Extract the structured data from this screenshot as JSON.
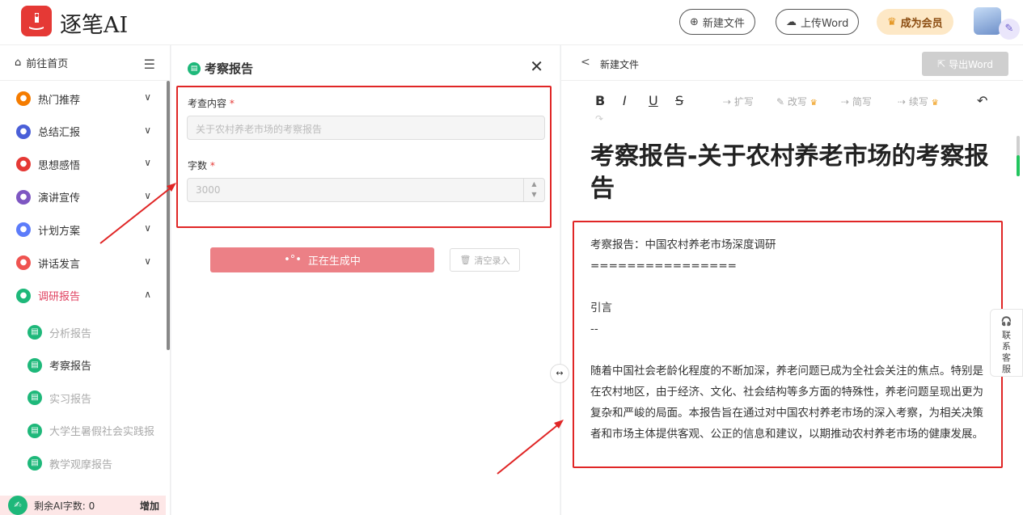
{
  "app": {
    "logo_text": "逐笔AI",
    "new_file_label": "新建文件",
    "upload_label": "上传Word",
    "vip_label": "成为会员"
  },
  "sidebar": {
    "home_label": "前往首页",
    "items": [
      {
        "label": "热门推荐",
        "icon_color": "#f57c00",
        "chevron": "∨"
      },
      {
        "label": "总结汇报",
        "icon_color": "#4a5fd8",
        "chevron": "∨"
      },
      {
        "label": "思想感悟",
        "icon_color": "#e53935",
        "chevron": "∨"
      },
      {
        "label": "演讲宣传",
        "icon_color": "#7e57c2",
        "chevron": "∨"
      },
      {
        "label": "计划方案",
        "icon_color": "#5c7cfa",
        "chevron": "∨"
      },
      {
        "label": "讲话发言",
        "icon_color": "#ef5350",
        "chevron": "∨"
      },
      {
        "label": "调研报告",
        "icon_color": "#1eb87a",
        "chevron": "∧"
      }
    ],
    "sub_items": [
      "分析报告",
      "考察报告",
      "实习报告",
      "大学生暑假社会实践报",
      "教学观摩报告"
    ],
    "remaining_label": "剩余AI字数: 0",
    "add_label": "增加"
  },
  "form": {
    "title": "考察报告",
    "close": "✕",
    "content_label": "考查内容",
    "content_placeholder": "关于农村养老市场的考察报告",
    "count_label": "字数",
    "count_placeholder": "3000",
    "required_mark": "*",
    "generate_label": "正在生成中",
    "clear_label": "清空录入"
  },
  "editor": {
    "file_label": "新建文件",
    "export_label": "导出Word",
    "toolbar": {
      "bold": "B",
      "italic": "I",
      "underline": "U",
      "strike": "S",
      "expand": "扩写",
      "rewrite": "改写",
      "simplify": "简写",
      "continue": "续写"
    },
    "doc_title": "考察报告-关于农村养老市场的考察报告",
    "body": {
      "line1": "考察报告：中国农村养老市场深度调研",
      "rule": "================",
      "intro_head": "引言",
      "intro_rule": "--",
      "paragraph": "随着中国社会老龄化程度的不断加深，养老问题已成为全社会关注的焦点。特别是在农村地区，由于经济、文化、社会结构等多方面的特殊性，养老问题呈现出更为复杂和严峻的局面。本报告旨在通过对中国农村养老市场的深入考察，为相关决策者和市场主体提供客观、公正的信息和建议，以期推动农村养老市场的健康发展。"
    },
    "support_label": "联系客服"
  }
}
